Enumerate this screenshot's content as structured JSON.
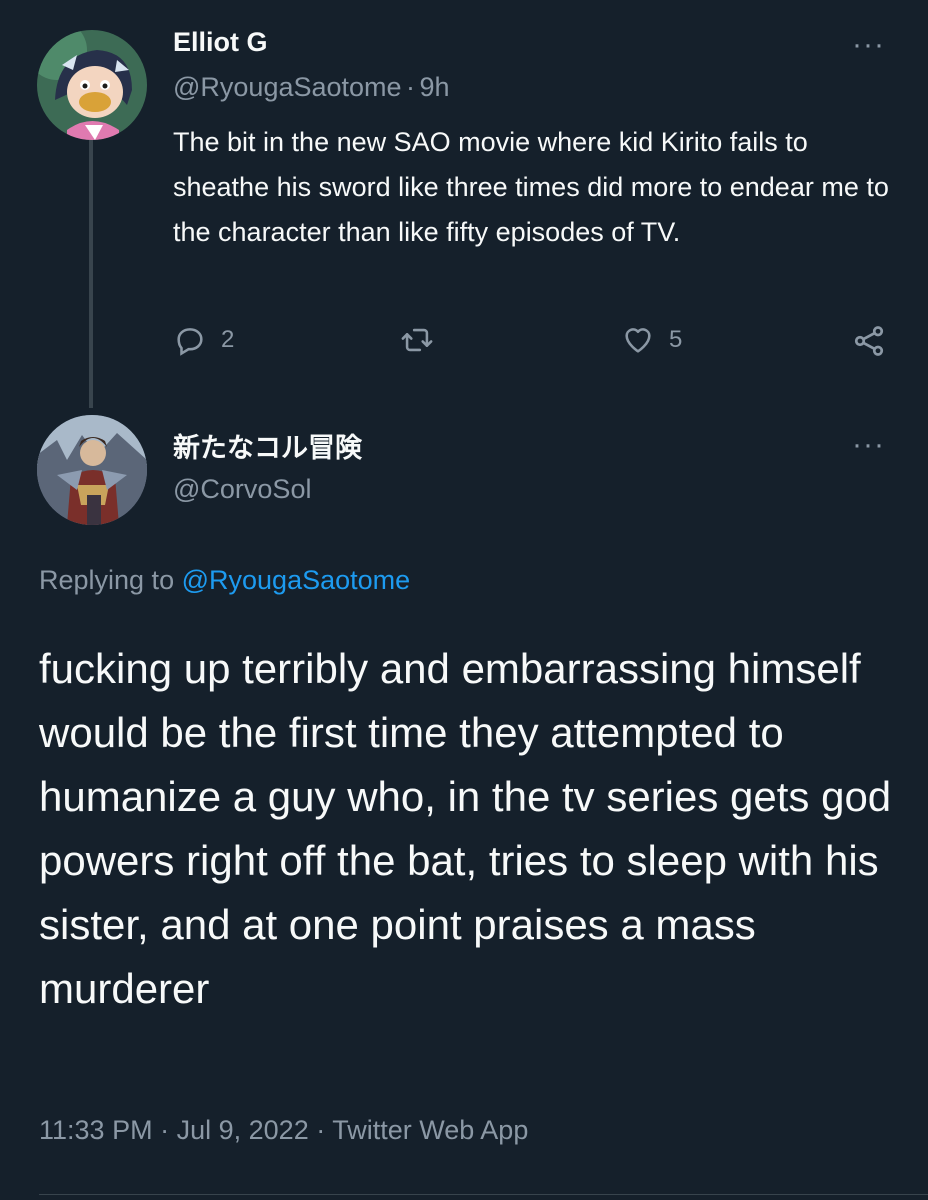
{
  "parent_tweet": {
    "display_name": "Elliot G",
    "handle": "@RyougaSaotome",
    "separator": "·",
    "time_ago": "9h",
    "text": "The bit in the new SAO movie where kid Kirito fails to sheathe his sword like three times did more to endear me to the character than like fifty episodes of TV.",
    "reply_count": "2",
    "like_count": "5",
    "more_label": "···",
    "icons": {
      "reply": "reply-icon",
      "retweet": "retweet-icon",
      "like": "heart-icon",
      "share": "share-icon"
    }
  },
  "reply_tweet": {
    "display_name": "新たなコル冒険",
    "handle": "@CorvoSol",
    "more_label": "···",
    "replying_prefix": "Replying to",
    "replying_handle": "@RyougaSaotome",
    "text": "fucking up terribly and embarrassing himself would be the first time they attempted to humanize a guy who, in the tv series gets god powers right off the bat, tries to sleep with his sister, and at one point praises a mass murderer",
    "time": "11:33 PM",
    "date": "Jul 9, 2022",
    "source": "Twitter Web App",
    "dot": "·"
  },
  "colors": {
    "background": "#15202b",
    "text_primary": "#f7f9f9",
    "text_secondary": "#8b98a5",
    "link": "#1d9bf0",
    "divider": "#38444d"
  }
}
